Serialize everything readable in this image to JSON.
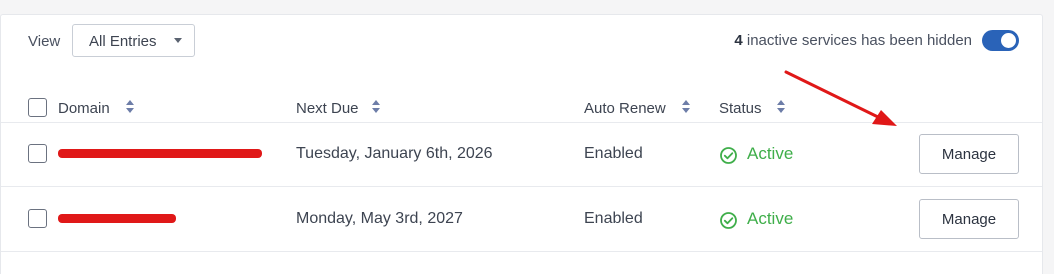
{
  "toolbar": {
    "view_label": "View",
    "view_select": "All Entries",
    "hidden_count": "4",
    "hidden_text": "inactive services has been hidden",
    "toggle_on": true
  },
  "columns": [
    "Domain",
    "Next Due",
    "Auto Renew",
    "Status"
  ],
  "rows": [
    {
      "next_due": "Tuesday, January 6th, 2026",
      "auto_renew": "Enabled",
      "status": "Active",
      "action": "Manage"
    },
    {
      "next_due": "Monday, May 3rd, 2027",
      "auto_renew": "Enabled",
      "status": "Active",
      "action": "Manage"
    }
  ],
  "colors": {
    "toggle": "#2a63b8",
    "status_active": "#3fae4a",
    "redaction": "#e01818",
    "annotation_arrow": "#e01818"
  },
  "icons": [
    "caret-down-icon",
    "sort-icon",
    "check-circle-icon",
    "arrow-annotation"
  ]
}
